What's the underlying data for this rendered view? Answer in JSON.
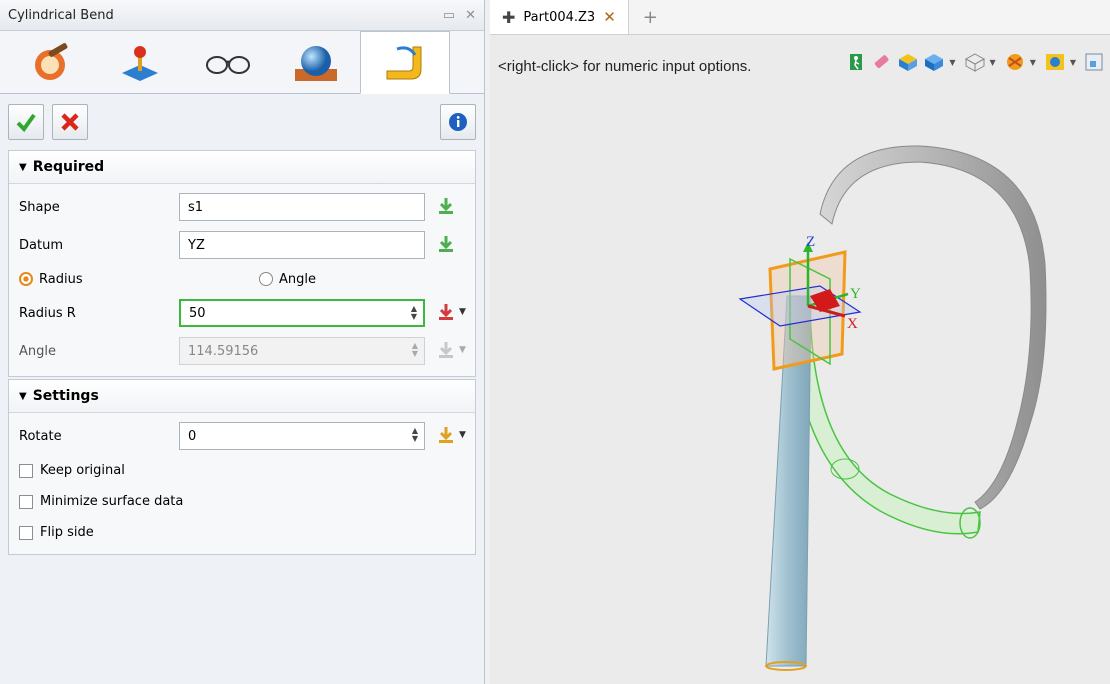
{
  "panel": {
    "title": "Cylindrical Bend",
    "icon_tabs": [
      "bend-tool-icon",
      "joystick-icon",
      "glasses-icon",
      "sphere-icon",
      "bend-active-icon"
    ],
    "actions": {
      "ok": "check-icon",
      "cancel": "x-icon",
      "info": "info-icon"
    }
  },
  "required": {
    "header": "Required",
    "shape_label": "Shape",
    "shape_value": "s1",
    "datum_label": "Datum",
    "datum_value": "YZ",
    "radio_radius": "Radius",
    "radio_angle": "Angle",
    "radius_label": "Radius R",
    "radius_value": "50",
    "angle_label": "Angle",
    "angle_value": "114.59156"
  },
  "settings": {
    "header": "Settings",
    "rotate_label": "Rotate",
    "rotate_value": "0",
    "keep_original": "Keep original",
    "minimize_surface": "Minimize surface data",
    "flip_side": "Flip side"
  },
  "viewport": {
    "tab_label": "Part004.Z3",
    "hint": "<right-click> for numeric input options.",
    "axis_x": "X",
    "axis_y": "Y",
    "axis_z": "Z"
  },
  "colors": {
    "accent_green": "#3cb83c",
    "accent_orange": "#e58a1a",
    "pick_green": "#4caf50",
    "pick_red": "#d23b3b"
  }
}
